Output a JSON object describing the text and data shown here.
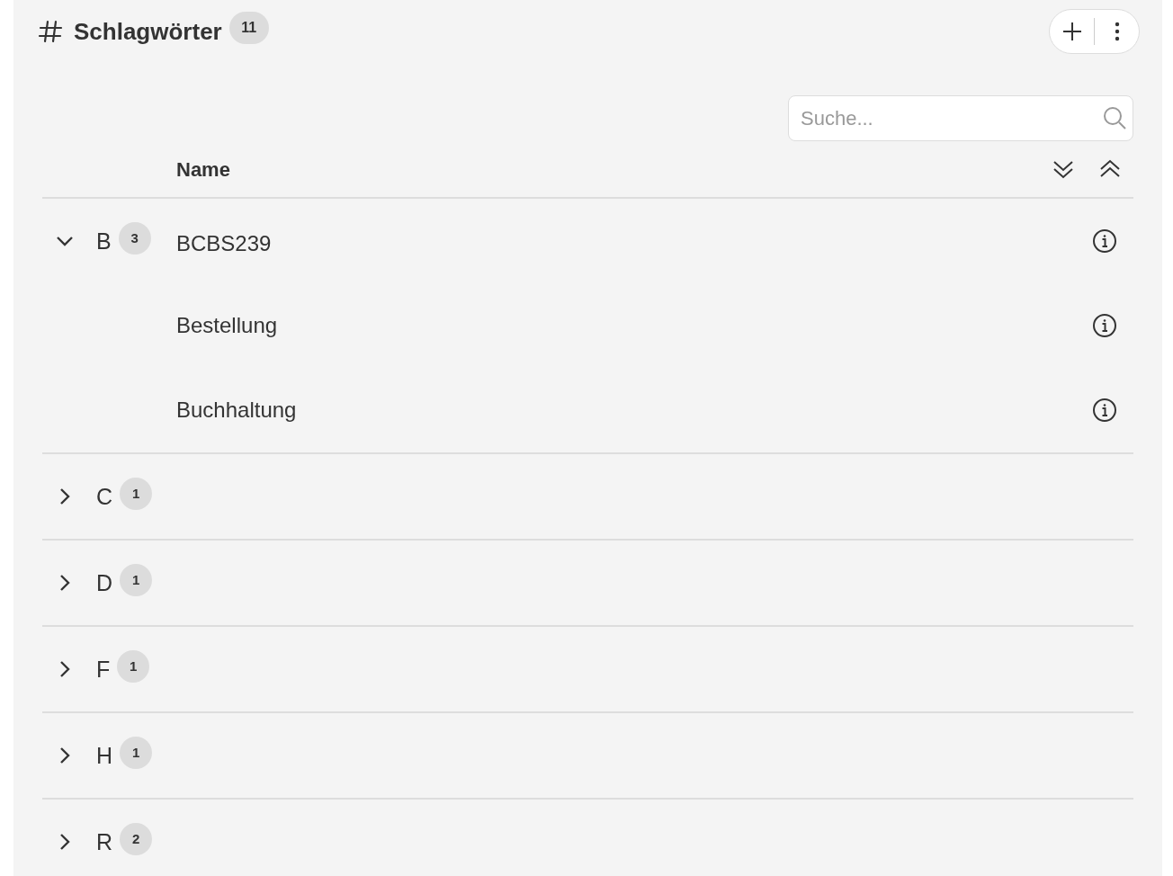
{
  "header": {
    "title": "Schlagwörter",
    "count": "11"
  },
  "search": {
    "placeholder": "Suche..."
  },
  "table": {
    "columns": [
      "Name"
    ],
    "groups": [
      {
        "letter": "B",
        "count": "3",
        "expanded": true,
        "items": [
          {
            "name": "BCBS239"
          },
          {
            "name": "Bestellung"
          },
          {
            "name": "Buchhaltung"
          }
        ]
      },
      {
        "letter": "C",
        "count": "1",
        "expanded": false
      },
      {
        "letter": "D",
        "count": "1",
        "expanded": false
      },
      {
        "letter": "F",
        "count": "1",
        "expanded": false
      },
      {
        "letter": "H",
        "count": "1",
        "expanded": false
      },
      {
        "letter": "R",
        "count": "2",
        "expanded": false
      }
    ]
  }
}
